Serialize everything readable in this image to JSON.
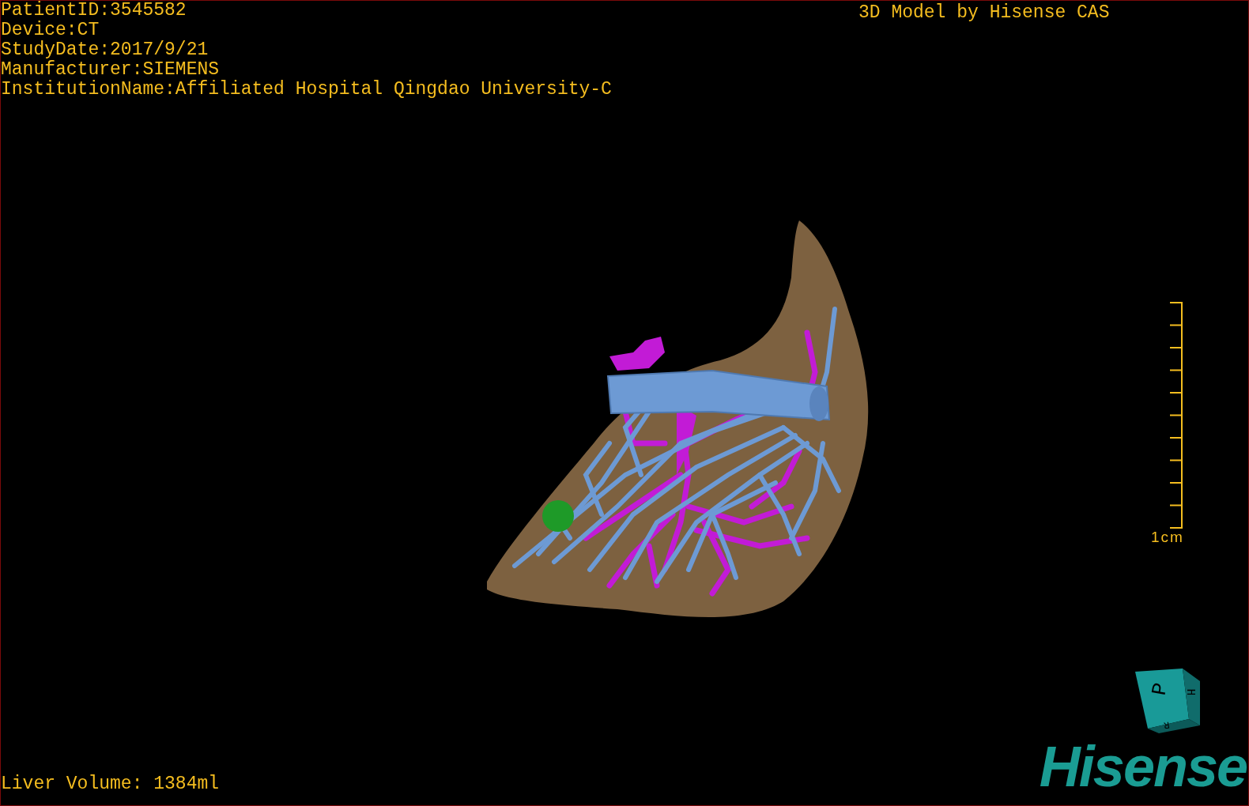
{
  "info_lines": [
    "PatientID:3545582",
    "Device:CT",
    "StudyDate:2017/9/21",
    "Manufacturer:SIEMENS",
    "InstitutionName:Affiliated Hospital Qingdao University-C"
  ],
  "title": "3D Model by Hisense CAS",
  "scale_bar": {
    "label": "1cm"
  },
  "liver_volume": "Liver Volume: 1384ml",
  "orientation_cube": {
    "faces": [
      "P",
      "H",
      "R"
    ]
  },
  "logo": "Hisense"
}
